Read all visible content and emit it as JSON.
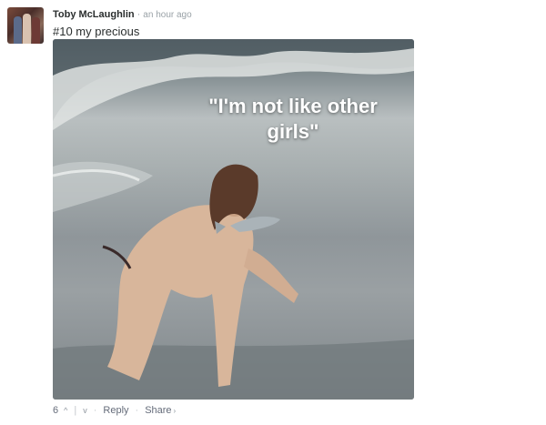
{
  "comment": {
    "author": "Toby McLaughlin",
    "separator": "·",
    "time": "an hour ago",
    "text": "#10 my precious",
    "image_caption": "\"I'm not like other girls\"",
    "image_subject": "woman crawling on beach with fish in mouth"
  },
  "actions": {
    "vote_count": "6",
    "upvote_glyph": "^",
    "downvote_glyph": "v",
    "reply_label": "Reply",
    "share_label": "Share",
    "share_chevron": "›",
    "dot": "·",
    "pipe": "|"
  }
}
